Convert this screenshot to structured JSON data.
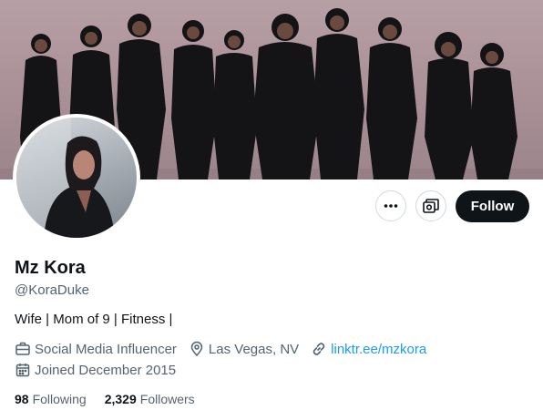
{
  "profile": {
    "name": "Mz Kora",
    "handle": "@KoraDuke",
    "bio": "Wife | Mom of 9 | Fitness |",
    "category": "Social Media Influencer",
    "location": "Las Vegas, NV",
    "website": "linktr.ee/mzkora",
    "joined": "Joined December 2015"
  },
  "actions": {
    "follow_label": "Follow",
    "more_icon": "more-horizontal-icon",
    "subscribe_icon": "subscription-icon"
  },
  "stats": {
    "following_count": "98",
    "following_label": "Following",
    "followers_count": "2,329",
    "followers_label": "Followers"
  },
  "colors": {
    "text": "#0f1419",
    "secondary": "#536471",
    "link": "#1d9bf0",
    "button_bg": "#0f1419",
    "border": "#cfd9de"
  }
}
